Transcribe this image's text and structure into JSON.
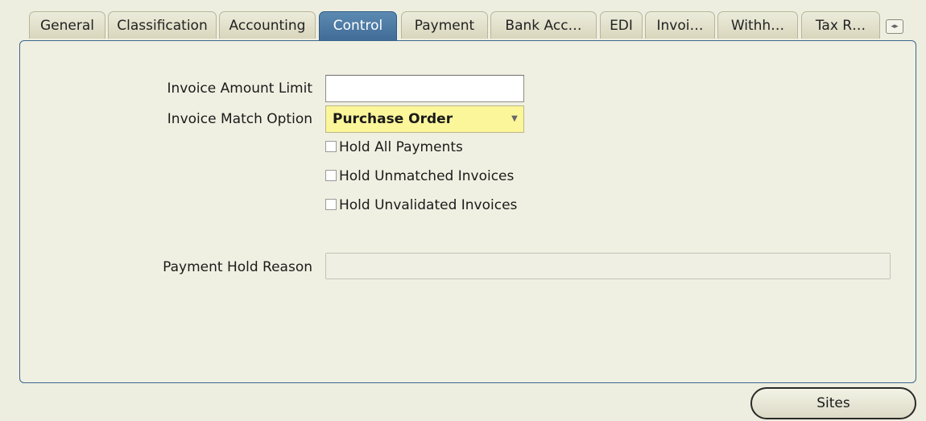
{
  "tabs": [
    {
      "label": "General"
    },
    {
      "label": "Classification"
    },
    {
      "label": "Accounting"
    },
    {
      "label": "Control"
    },
    {
      "label": "Payment"
    },
    {
      "label": "Bank Acc…"
    },
    {
      "label": "EDI"
    },
    {
      "label": "Invoi…"
    },
    {
      "label": "Withh…"
    },
    {
      "label": "Tax R…"
    }
  ],
  "active_tab": "Control",
  "form": {
    "invoice_amount_limit_label": "Invoice Amount Limit",
    "invoice_amount_limit_value": "",
    "invoice_match_option_label": "Invoice Match Option",
    "invoice_match_option_value": "Purchase Order",
    "hold_all_payments_label": "Hold All Payments",
    "hold_unmatched_invoices_label": "Hold Unmatched Invoices",
    "hold_unvalidated_invoices_label": "Hold Unvalidated Invoices",
    "payment_hold_reason_label": "Payment Hold Reason",
    "payment_hold_reason_value": ""
  },
  "checkboxes": {
    "hold_all_payments": false,
    "hold_unmatched_invoices": false,
    "hold_unvalidated_invoices": false
  },
  "buttons": {
    "sites_label": "Sites"
  },
  "colors": {
    "active_tab": "#3e6a95",
    "panel_border": "#3a6690",
    "required_field": "#fbf69a"
  }
}
